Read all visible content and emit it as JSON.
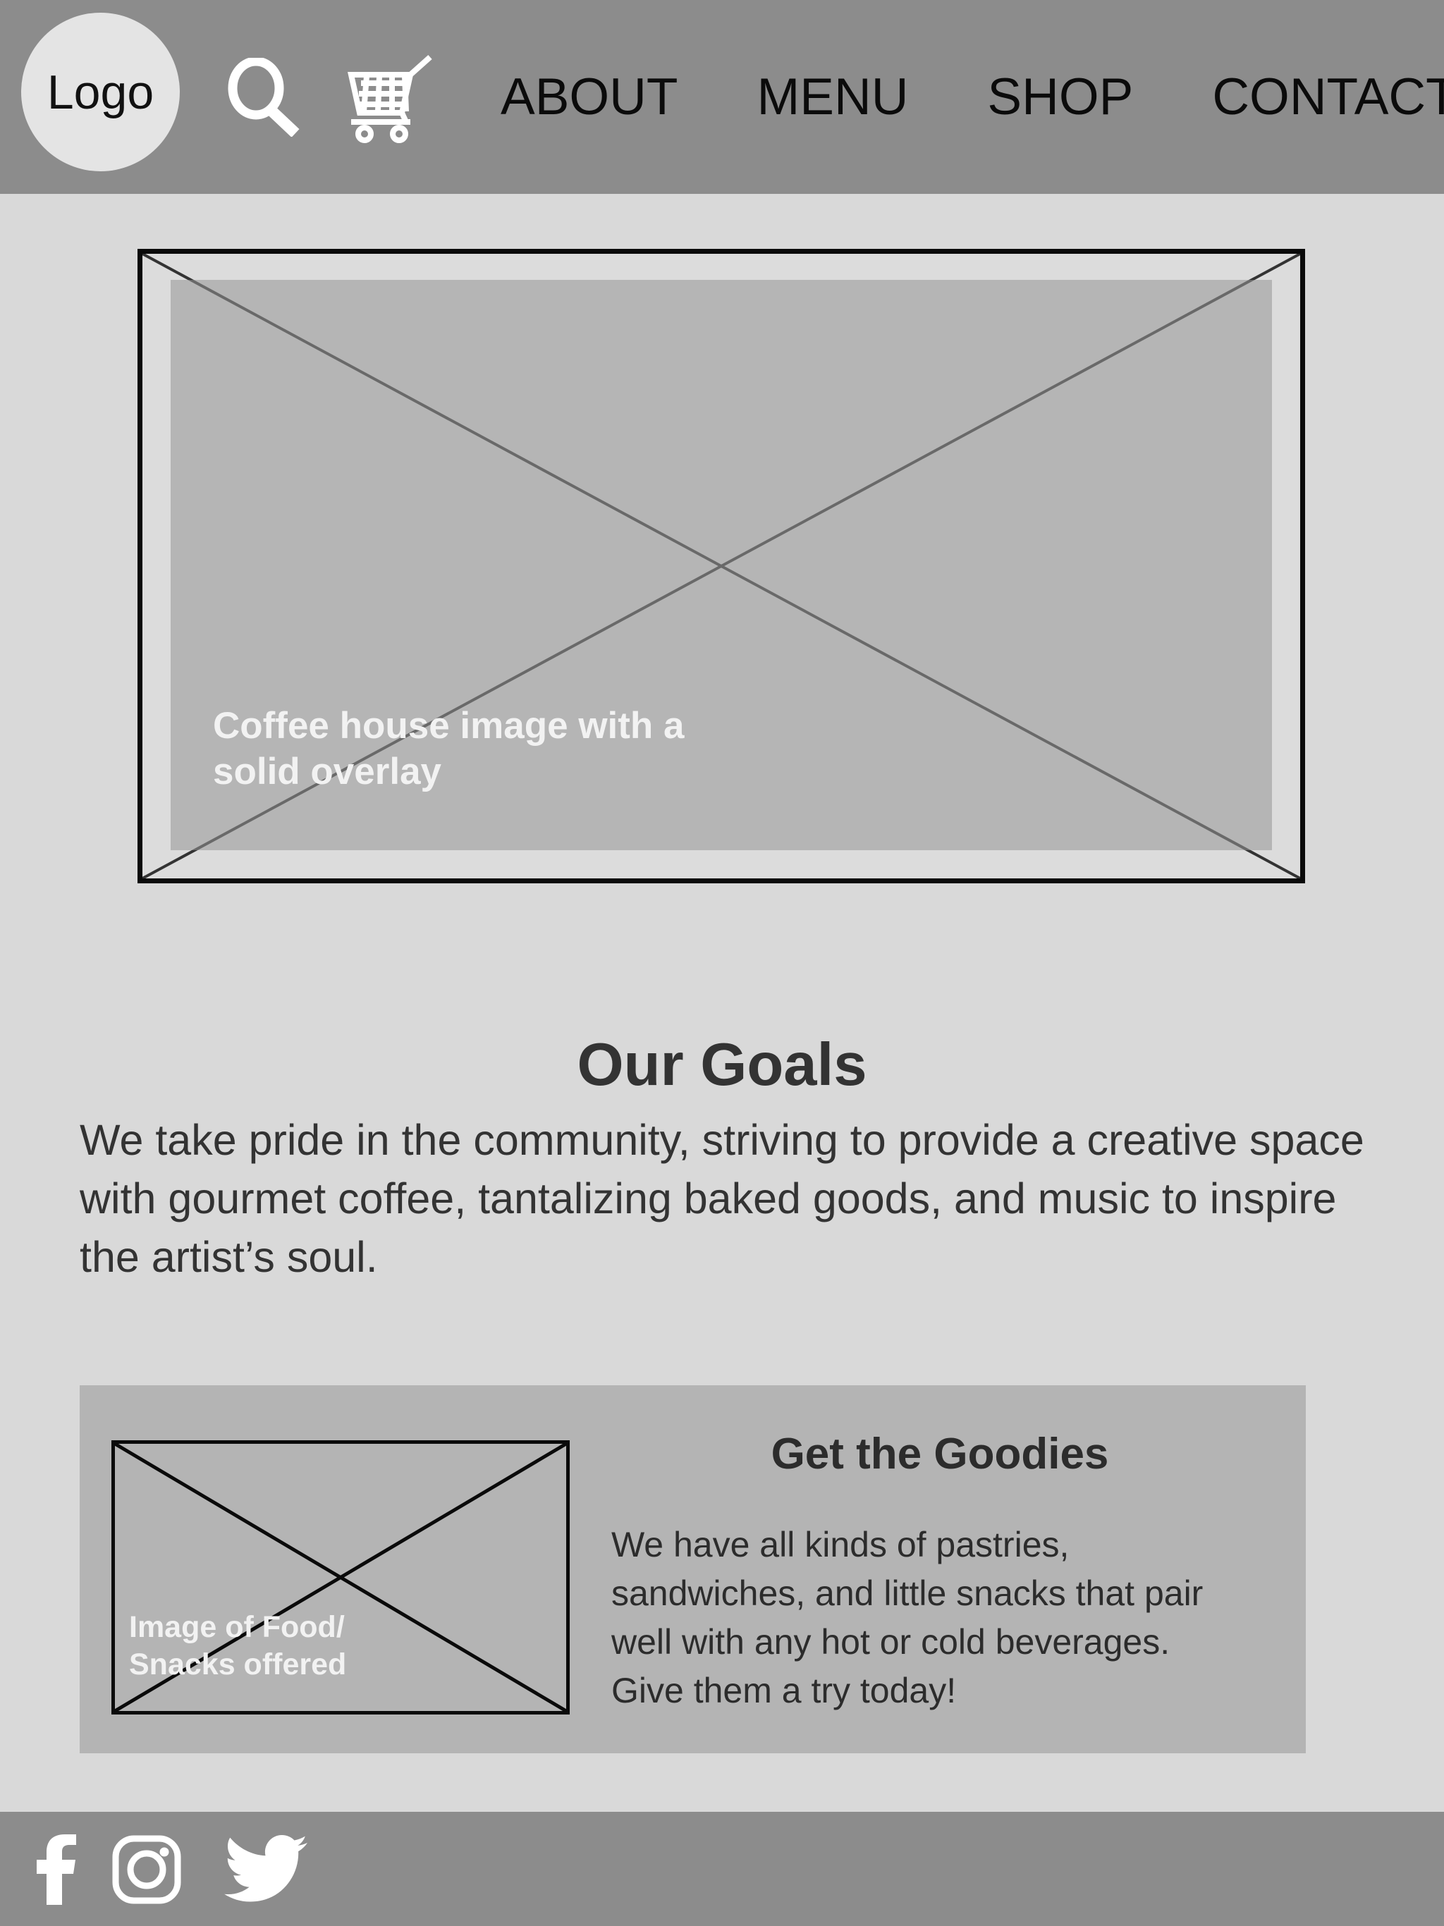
{
  "colors": {
    "header_bar": "#8c8c8c",
    "page_background": "#d9d9d9",
    "hero_overlay": "#bcbcbc",
    "goodies_panel": "#b4b4b4",
    "frame_stroke": "#0a0a0a",
    "heading_text": "#333333",
    "light_text": "#f2f2f2"
  },
  "header": {
    "logo_label": "Logo",
    "icons": [
      {
        "name": "search-icon",
        "label": "Search"
      },
      {
        "name": "shopping-cart-icon",
        "label": "Cart"
      }
    ],
    "nav_items": [
      {
        "label": "ABOUT"
      },
      {
        "label": "MENU"
      },
      {
        "label": "SHOP"
      },
      {
        "label": "CONTACT"
      }
    ]
  },
  "hero": {
    "caption": "Coffee house image with a solid overlay",
    "placeholder_type": "crossed-box"
  },
  "goals": {
    "title": "Our Goals",
    "body": "We take pride in the community, striving to provide a creative space with gourmet coffee, tantalizing baked goods, and music to inspire the artist’s soul."
  },
  "goodies": {
    "image_label": "Image of Food/ Snacks offered",
    "heading": "Get the Goodies",
    "body": "We have all kinds of pastries, sandwiches, and little snacks that pair well with any hot or cold beverages. Give them a try today!"
  },
  "footer": {
    "social": [
      {
        "name": "facebook-icon",
        "label": "Facebook"
      },
      {
        "name": "instagram-icon",
        "label": "Instagram"
      },
      {
        "name": "twitter-icon",
        "label": "Twitter"
      }
    ]
  }
}
